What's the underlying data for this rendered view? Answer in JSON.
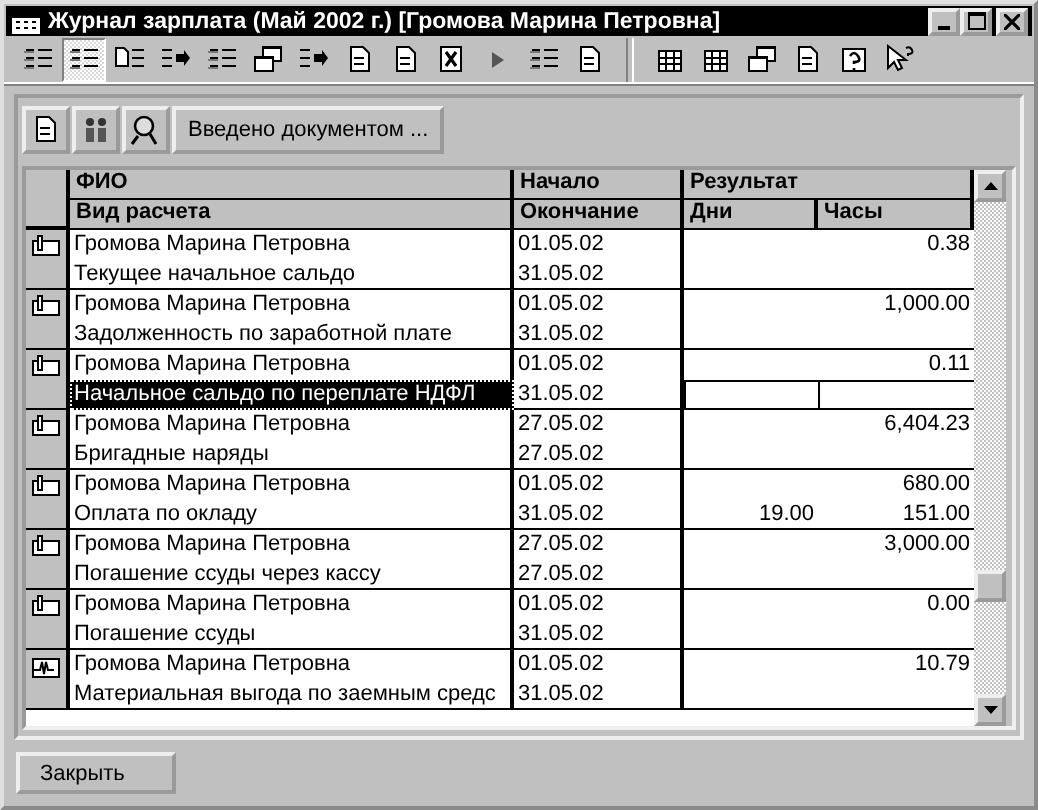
{
  "window": {
    "title": "Журнал зарплата (Май 2002 г.) [Громова Марина Петровна]"
  },
  "toolbar": [
    {
      "kind": "list",
      "pressed": false
    },
    {
      "kind": "list",
      "pressed": true
    },
    {
      "kind": "doclist",
      "pressed": false
    },
    {
      "kind": "arrow",
      "pressed": false
    },
    {
      "kind": "list",
      "pressed": false
    },
    {
      "kind": "copy",
      "pressed": false
    },
    {
      "kind": "arrow",
      "pressed": false
    },
    {
      "kind": "doc",
      "pressed": false
    },
    {
      "kind": "doc",
      "pressed": false
    },
    {
      "kind": "docx",
      "pressed": false
    },
    {
      "kind": "play",
      "pressed": false
    },
    {
      "kind": "list",
      "pressed": false
    },
    {
      "kind": "doc",
      "pressed": false
    },
    {
      "kind": "sep"
    },
    {
      "kind": "table",
      "pressed": false
    },
    {
      "kind": "table",
      "pressed": false
    },
    {
      "kind": "copy",
      "pressed": false
    },
    {
      "kind": "doc",
      "pressed": false
    },
    {
      "kind": "help",
      "pressed": false
    },
    {
      "kind": "pointer",
      "pressed": false
    }
  ],
  "subtoolbar": {
    "icons": [
      {
        "kind": "doc"
      },
      {
        "kind": "people"
      },
      {
        "kind": "search"
      }
    ],
    "button": "Введено документом ..."
  },
  "table": {
    "columns": [
      {
        "top": "ФИО",
        "bottom": "Вид расчета"
      },
      {
        "top": "Начало",
        "bottom": "Окончание"
      },
      {
        "top": "Результат",
        "bottom": "Дни",
        "bottom2": "Часы"
      }
    ],
    "rows": [
      {
        "kind": "doc",
        "name": "Громова Марина Петровна",
        "calc": "Текущее начальное сальдо",
        "start": "01.05.02",
        "end": "31.05.02",
        "result": "0.38",
        "selected": false
      },
      {
        "kind": "doc",
        "name": "Громова Марина Петровна",
        "calc": "Задолженность по заработной плате",
        "start": "01.05.02",
        "end": "31.05.02",
        "result": "1,000.00",
        "selected": false
      },
      {
        "kind": "doc",
        "name": "Громова Марина Петровна",
        "calc": "Начальное сальдо по переплате НДФЛ",
        "start": "01.05.02",
        "end": "31.05.02",
        "result": "0.11",
        "selected": true
      },
      {
        "kind": "doc",
        "name": "Громова Марина Петровна",
        "calc": "Бригадные наряды",
        "start": "27.05.02",
        "end": "27.05.02",
        "result": "6,404.23",
        "selected": false
      },
      {
        "kind": "doc",
        "name": "Громова Марина Петровна",
        "calc": "Оплата по окладу",
        "start": "01.05.02",
        "end": "31.05.02",
        "result": "680.00",
        "days": "19.00",
        "hours": "151.00",
        "selected": false
      },
      {
        "kind": "doc",
        "name": "Громова Марина Петровна",
        "calc": "Погашение ссуды через кассу",
        "start": "27.05.02",
        "end": "27.05.02",
        "result": "3,000.00",
        "selected": false
      },
      {
        "kind": "doc",
        "name": "Громова Марина Петровна",
        "calc": "Погашение ссуды",
        "start": "01.05.02",
        "end": "31.05.02",
        "result": "0.00",
        "selected": false
      },
      {
        "kind": "calc",
        "name": "Громова Марина Петровна",
        "calc": "Материальная выгода по заемным средс",
        "start": "01.05.02",
        "end": "31.05.02",
        "result": "10.79",
        "selected": false
      }
    ]
  },
  "buttons": [
    "Закрыть"
  ]
}
